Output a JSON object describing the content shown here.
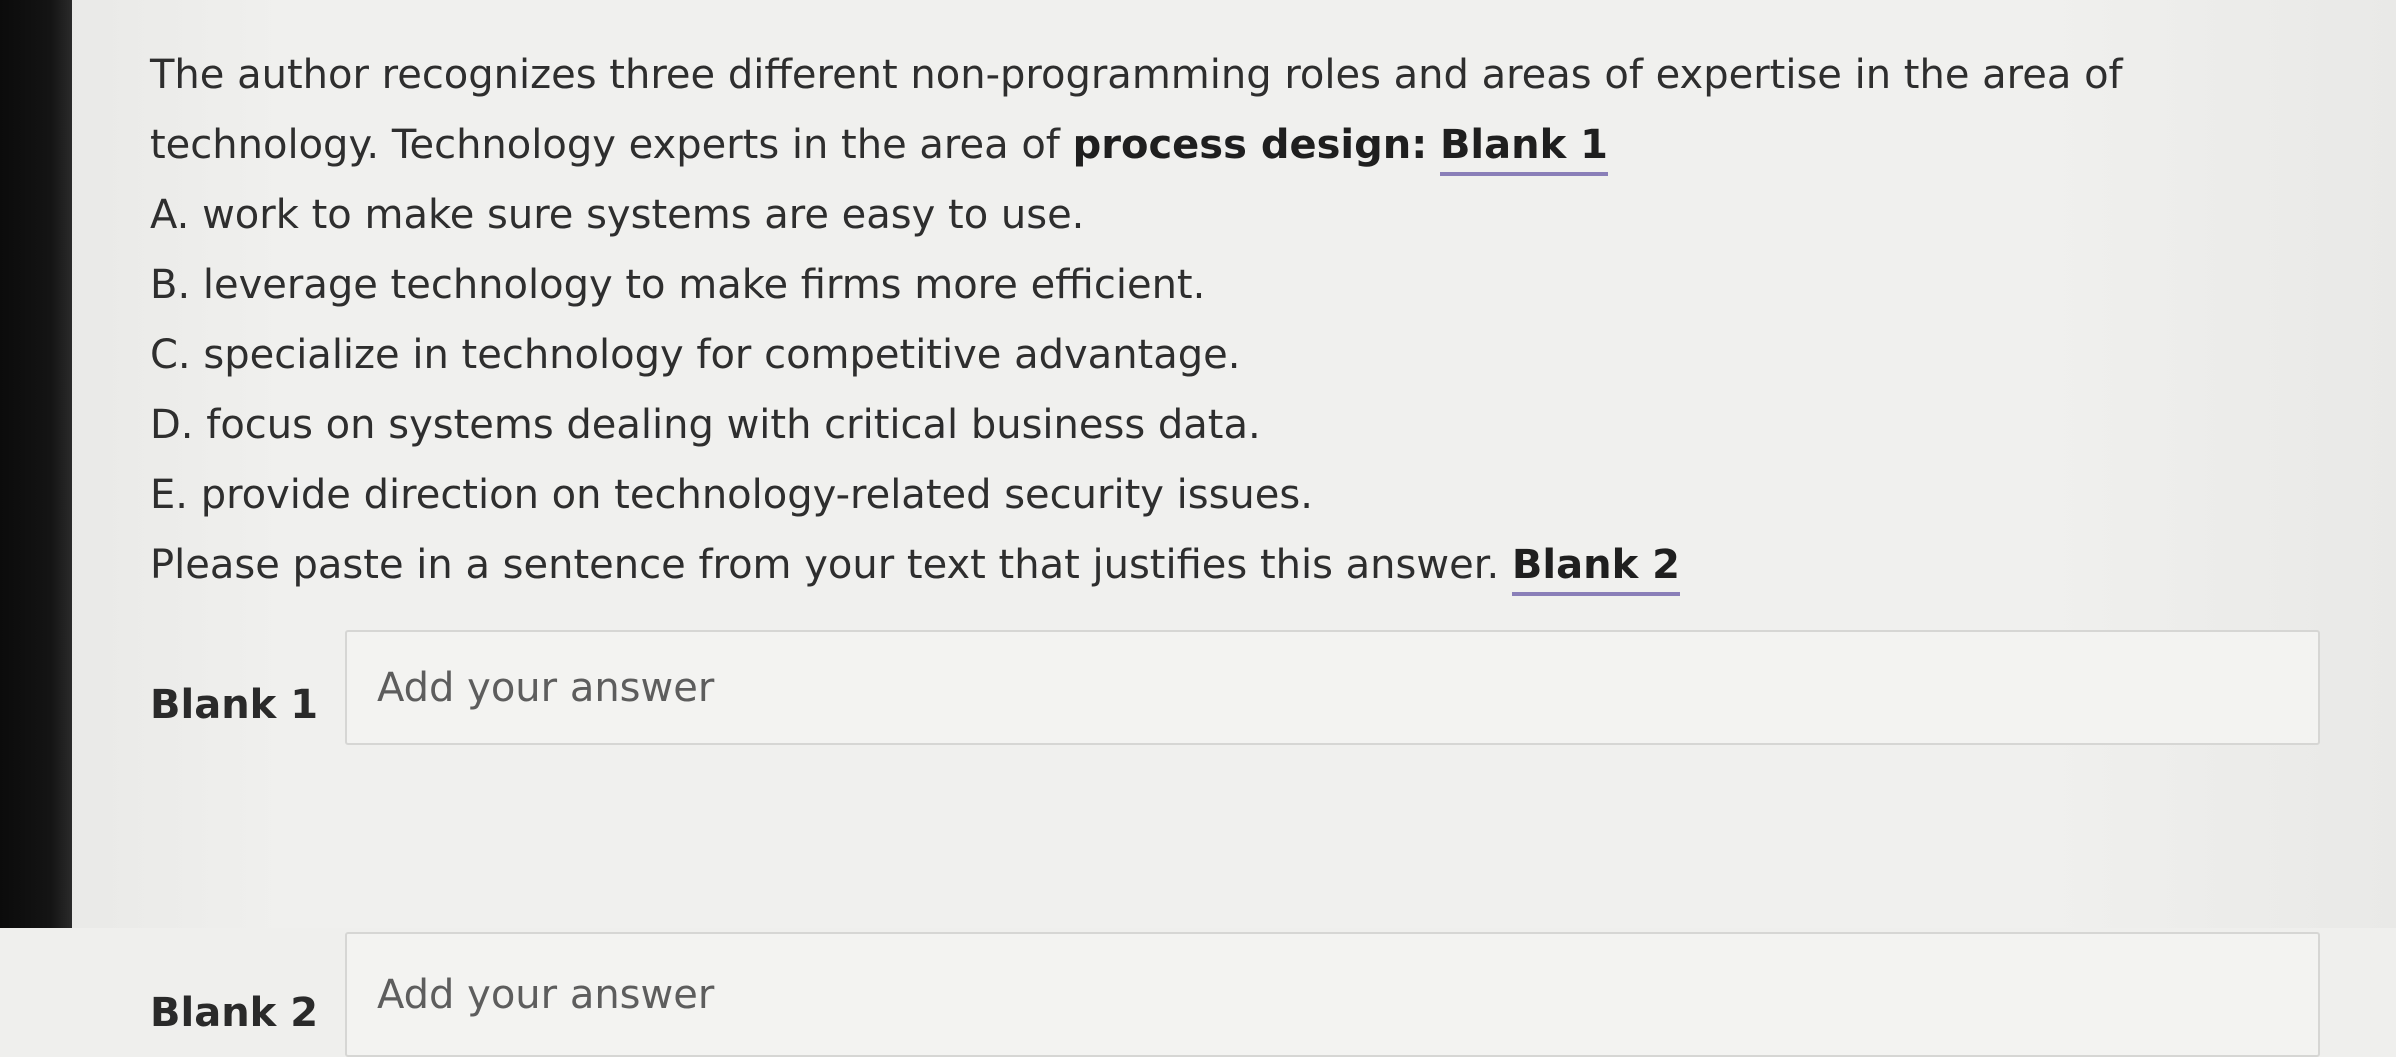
{
  "question": {
    "line1": "The author recognizes three different non-programming roles and areas of expertise in the area of",
    "line2_prefix": "technology.  Technology experts in the area of ",
    "line2_bold": "process design:",
    "line2_blank": "Blank 1",
    "options": [
      "A. work to make sure systems are easy to use.",
      "B. leverage technology to make firms more efficient.",
      "C. specialize in technology for competitive advantage.",
      "D. focus on systems dealing with critical business data.",
      "E. provide direction on technology-related security issues."
    ],
    "justify_prefix": "Please paste in a sentence from your text that justifies this answer. ",
    "justify_blank": "Blank 2"
  },
  "answers": {
    "blank1": {
      "label": "Blank 1",
      "placeholder": "Add your answer",
      "value": ""
    },
    "blank2": {
      "label": "Blank 2",
      "placeholder": "Add your answer",
      "value": ""
    }
  },
  "colors": {
    "background": "#efefed",
    "blank_underline": "#8a7fb8",
    "text": "#2e2e2e"
  }
}
